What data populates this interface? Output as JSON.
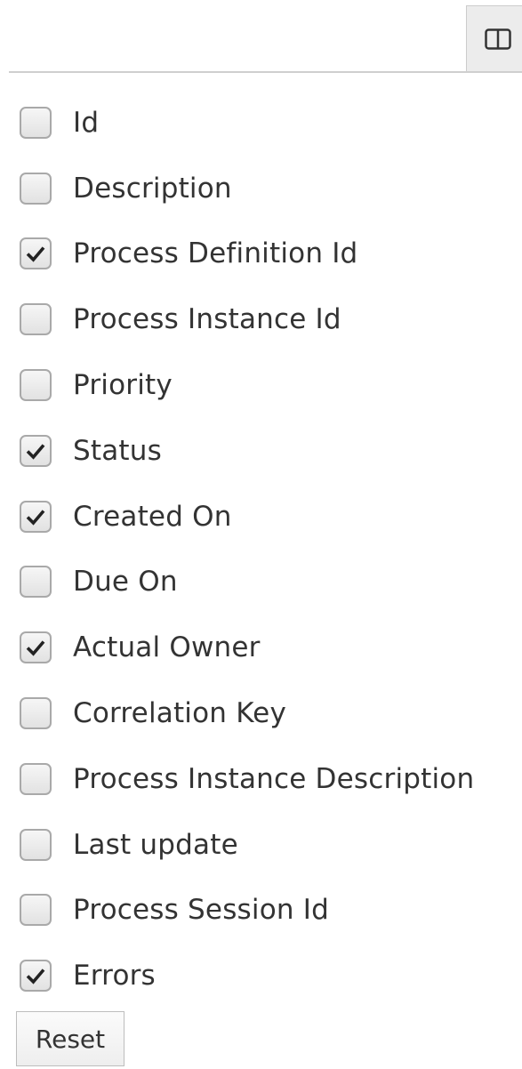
{
  "toolbar": {
    "columns_button_icon": "columns-icon"
  },
  "options": [
    {
      "label": "Id",
      "checked": false
    },
    {
      "label": "Description",
      "checked": false
    },
    {
      "label": "Process Definition Id",
      "checked": true
    },
    {
      "label": "Process Instance Id",
      "checked": false
    },
    {
      "label": "Priority",
      "checked": false
    },
    {
      "label": "Status",
      "checked": true
    },
    {
      "label": "Created On",
      "checked": true
    },
    {
      "label": "Due On",
      "checked": false
    },
    {
      "label": "Actual Owner",
      "checked": true
    },
    {
      "label": "Correlation Key",
      "checked": false
    },
    {
      "label": "Process Instance Description",
      "checked": false
    },
    {
      "label": "Last update",
      "checked": false
    },
    {
      "label": "Process Session Id",
      "checked": false
    },
    {
      "label": "Errors",
      "checked": true
    }
  ],
  "reset_label": "Reset",
  "colors": {
    "text": "#333333",
    "checkbox_border": "#a9a9a9",
    "button_bg": "#ececec"
  }
}
